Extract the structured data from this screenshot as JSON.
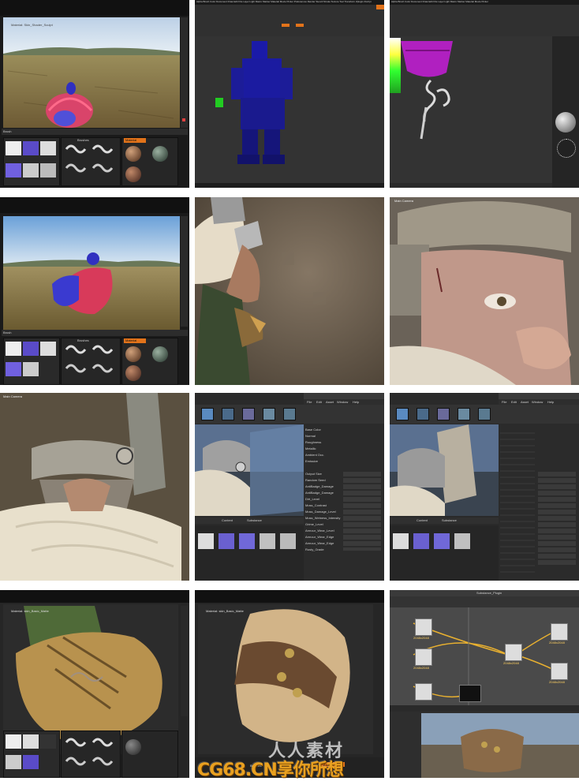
{
  "tiles": {
    "r1c1": {
      "top_label": "Material: Skin_Shader_Sculpt",
      "panel_title": "Brush",
      "tabs": [
        "Brushes",
        "Material"
      ]
    },
    "r1c2": {
      "menu": "Alpha Brush Color Document Draw Edit File Layer Light Macro Marker Material Movie Picker Preferences Render Stencil Stroke Texture Tool Transform Zplugin Zscript"
    },
    "r1c3": {
      "menu": "Alpha Brush Color Document Draw Edit File Layer Light Macro Marker Material Movie Picker"
    },
    "r2c1": {
      "panel_title": "Brush",
      "tabs": [
        "Brushes",
        "Material"
      ]
    },
    "r3c2": {
      "menu": [
        "File",
        "Edit",
        "Asset",
        "Window",
        "Help"
      ],
      "breadcrumb": [
        "Content",
        "Substance"
      ],
      "props": [
        "Base Color",
        "Normal",
        "Roughness",
        "Metallic",
        "Ambient Occ.",
        "Emissive",
        "Output Size",
        "Random Seed",
        "AntiBadge_Damage",
        "AntiBadge_Damage",
        "Dirt_Level",
        "Moss_Contrast",
        "Moss_Damage_Level",
        "Moss_Wetness_Intensity",
        "Grime_Level",
        "Armour_Wear_Level",
        "Armour_Wear_Edge",
        "Armour_Wear_Edge",
        "Rusty_Grade"
      ]
    },
    "r3c3": {
      "menu": [
        "File",
        "Edit",
        "Asset",
        "Window",
        "Help"
      ],
      "breadcrumb": [
        "Content",
        "Substance"
      ]
    },
    "r4c1": {
      "top_label": "Material: skin_Basic_Matte"
    },
    "r4c2": {
      "top_label": "Material: skin_Basic_Matte",
      "tabs": [
        "Brushes",
        "Material"
      ]
    },
    "r4c3": {
      "title": "Substance_Plugin",
      "node_labels": [
        "2048x2048",
        "2048x2048",
        "2048x2048",
        "2048x2048",
        "2048x2048"
      ]
    }
  },
  "watermark": {
    "brand": "CG68.CN",
    "slogan": "享你所想",
    "top": "人人素材"
  }
}
